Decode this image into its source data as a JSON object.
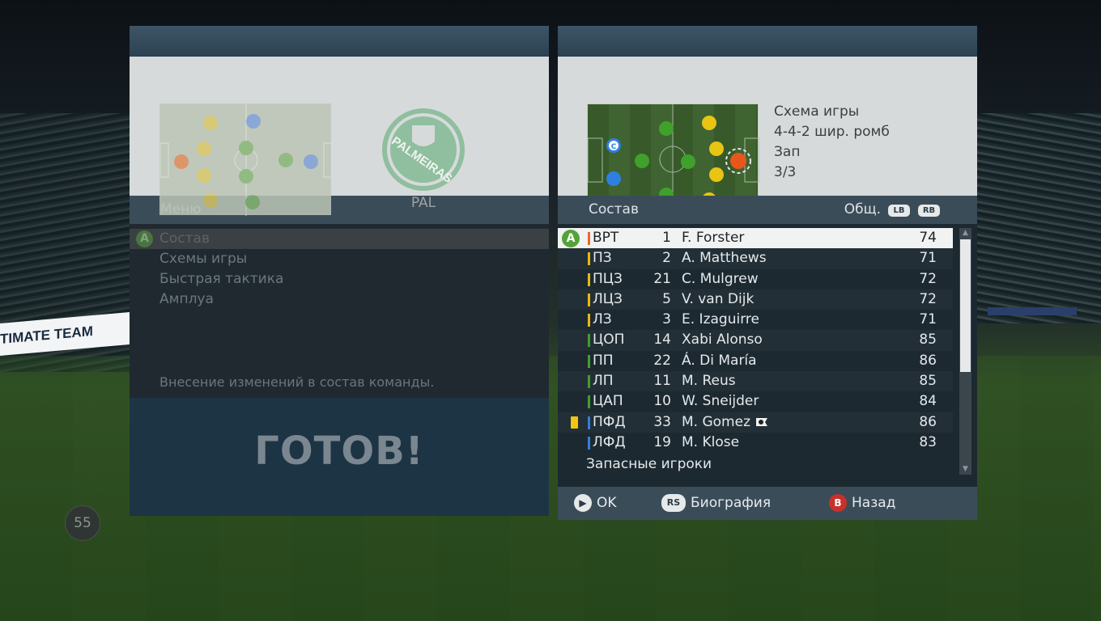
{
  "background": {
    "ad_board_text": "TIMATE TEAM",
    "timer": "55"
  },
  "left_panel": {
    "club_abbr": "PAL",
    "club_name": "PALMEIRAS",
    "menu_header": "Меню",
    "menu_items": [
      {
        "label": "Состав",
        "selected": true,
        "button": "A"
      },
      {
        "label": "Схемы игры"
      },
      {
        "label": "Быстрая тактика"
      },
      {
        "label": "Амплуа"
      }
    ],
    "hint": "Внесение изменений в состав команды.",
    "ready": "ГОТОВ!"
  },
  "right_panel": {
    "formation_info": {
      "line1": "Схема игры",
      "line2": "4-4-2 шир. ромб",
      "line3": "Зап",
      "line4": "3/3"
    },
    "squad_header": "Состав",
    "sort_label": "Общ.",
    "lb": "LB",
    "rb": "RB",
    "players": [
      {
        "pos": "ВРТ",
        "num": "1",
        "name": "F. Forster",
        "ovr": "74",
        "color": "#e8692a",
        "selected": true,
        "button": "A"
      },
      {
        "pos": "ПЗ",
        "num": "2",
        "name": "A. Matthews",
        "ovr": "71",
        "color": "#e8b713"
      },
      {
        "pos": "ПЦЗ",
        "num": "21",
        "name": "C. Mulgrew",
        "ovr": "72",
        "color": "#e8b713"
      },
      {
        "pos": "ЛЦЗ",
        "num": "5",
        "name": "V. van Dijk",
        "ovr": "72",
        "color": "#e8b713"
      },
      {
        "pos": "ЛЗ",
        "num": "3",
        "name": "E. Izaguirre",
        "ovr": "71",
        "color": "#e8b713"
      },
      {
        "pos": "ЦОП",
        "num": "14",
        "name": "Xabi Alonso",
        "ovr": "85",
        "color": "#3fa12c"
      },
      {
        "pos": "ПП",
        "num": "22",
        "name": "Á. Di María",
        "ovr": "86",
        "color": "#3fa12c"
      },
      {
        "pos": "ЛП",
        "num": "11",
        "name": "M. Reus",
        "ovr": "85",
        "color": "#3fa12c"
      },
      {
        "pos": "ЦАП",
        "num": "10",
        "name": "W. Sneijder",
        "ovr": "84",
        "color": "#3fa12c"
      },
      {
        "pos": "ПФД",
        "num": "33",
        "name": "M. Gomez",
        "ovr": "86",
        "color": "#2f7fe0",
        "card": "yellow",
        "icon": "ball-flag-icon"
      },
      {
        "pos": "ЛФД",
        "num": "19",
        "name": "M. Klose",
        "ovr": "83",
        "color": "#2f7fe0"
      }
    ],
    "subs_label": "Запасные игроки",
    "footer": {
      "ok": "OK",
      "bio": "Биография",
      "back": "Назад",
      "ok_button": "▶",
      "bio_button": "RS",
      "back_button": "B"
    }
  }
}
